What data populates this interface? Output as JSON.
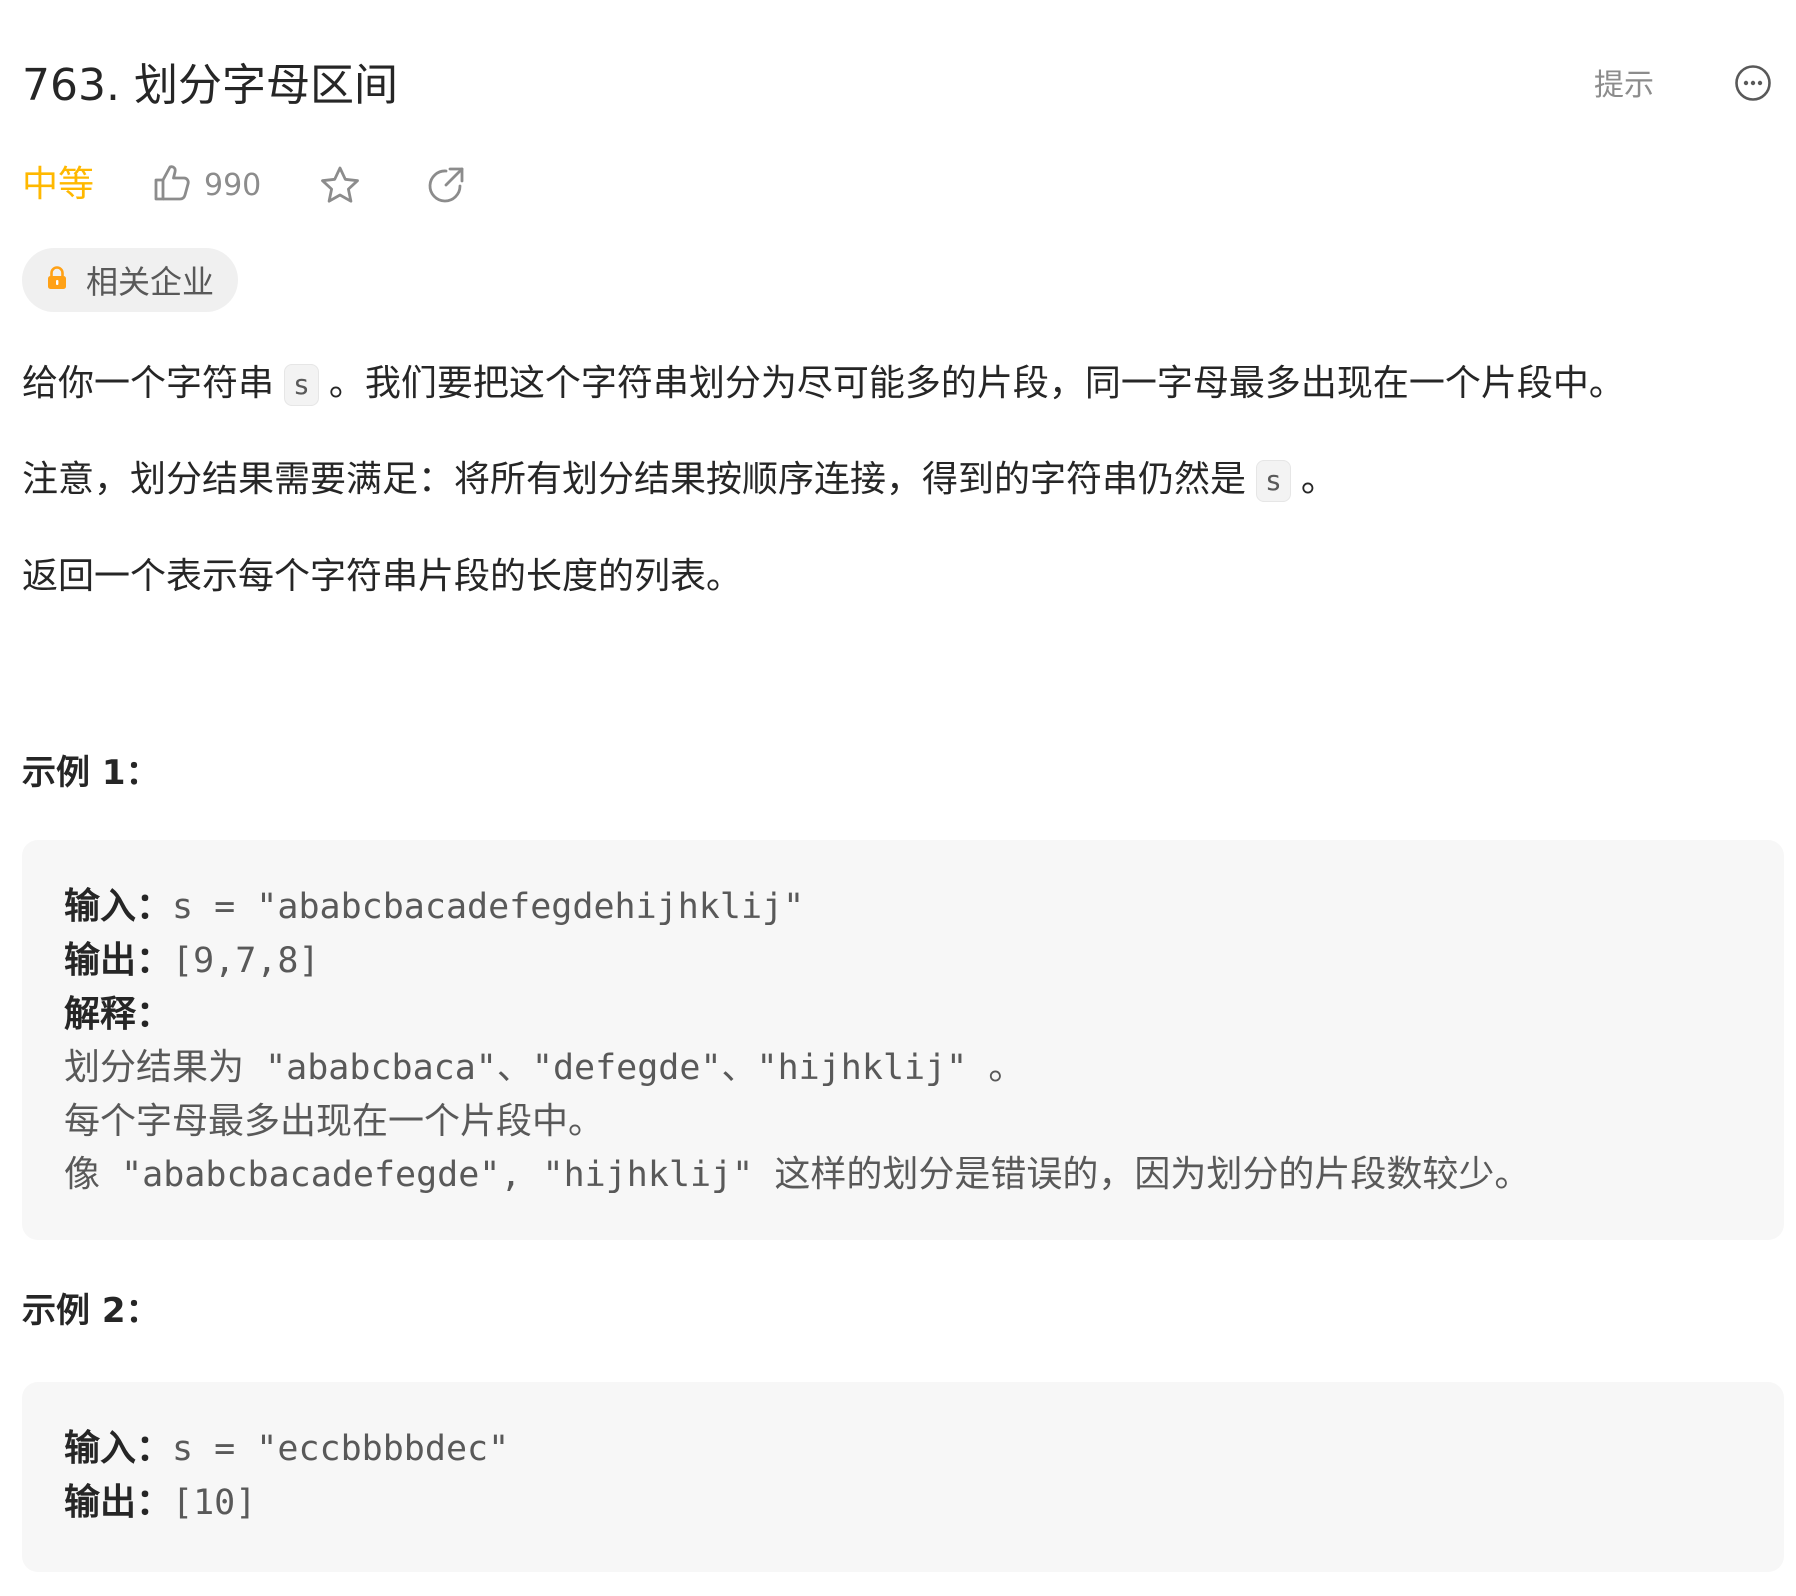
{
  "header": {
    "title": "763. 划分字母区间",
    "hint_label": "提示",
    "more_icon": "more-icon"
  },
  "meta": {
    "difficulty": "中等",
    "difficulty_color": "#ffb800",
    "like_count": "990"
  },
  "company_tag": {
    "label": "相关企业",
    "lock_color": "#ffa116"
  },
  "description": {
    "p1_before": "给你一个字符串",
    "p1_code": "s",
    "p1_after": "。我们要把这个字符串划分为尽可能多的片段，同一字母最多出现在一个片段中。",
    "p2_before": "注意，划分结果需要满足：将所有划分结果按顺序连接，得到的字符串仍然是",
    "p2_code": "s",
    "p2_after": "。",
    "p3": "返回一个表示每个字符串片段的长度的列表。"
  },
  "examples": [
    {
      "heading": "示例 1：",
      "input_label": "输入：",
      "input_value": "s = \"ababcbacadefegdehijhklij\"",
      "output_label": "输出：",
      "output_value": "[9,7,8]",
      "explain_label": "解释：",
      "explain_line1_a": "划分结果为",
      "explain_line1_b": " \"ababcbaca\"、\"defegde\"、\"hijhklij\" ",
      "explain_line1_c": "。",
      "explain_line2": "每个字母最多出现在一个片段中。",
      "explain_line3_a": "像",
      "explain_line3_b": " \"ababcbacadefegde\", \"hijhklij\" ",
      "explain_line3_c": "这样的划分是错误的，因为划分的片段数较少。"
    },
    {
      "heading": "示例 2：",
      "input_label": "输入：",
      "input_value": "s = \"eccbbbbdec\"",
      "output_label": "输出：",
      "output_value": "[10]"
    }
  ]
}
